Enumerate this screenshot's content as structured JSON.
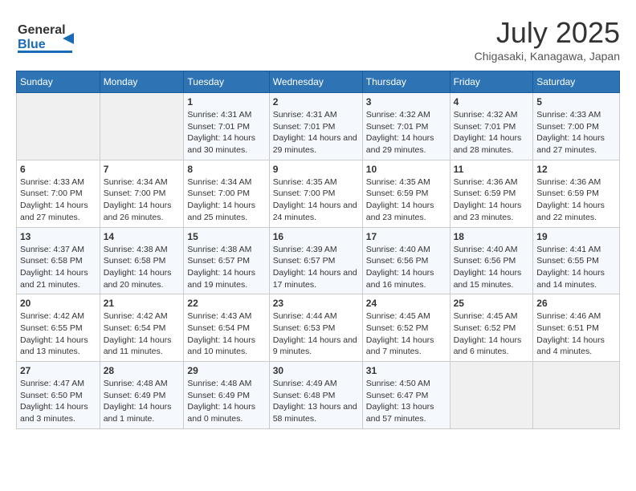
{
  "logo": {
    "line1": "General",
    "line2": "Blue"
  },
  "title": "July 2025",
  "subtitle": "Chigasaki, Kanagawa, Japan",
  "days_of_week": [
    "Sunday",
    "Monday",
    "Tuesday",
    "Wednesday",
    "Thursday",
    "Friday",
    "Saturday"
  ],
  "weeks": [
    [
      {
        "day": "",
        "sunrise": "",
        "sunset": "",
        "daylight": ""
      },
      {
        "day": "",
        "sunrise": "",
        "sunset": "",
        "daylight": ""
      },
      {
        "day": "1",
        "sunrise": "Sunrise: 4:31 AM",
        "sunset": "Sunset: 7:01 PM",
        "daylight": "Daylight: 14 hours and 30 minutes."
      },
      {
        "day": "2",
        "sunrise": "Sunrise: 4:31 AM",
        "sunset": "Sunset: 7:01 PM",
        "daylight": "Daylight: 14 hours and 29 minutes."
      },
      {
        "day": "3",
        "sunrise": "Sunrise: 4:32 AM",
        "sunset": "Sunset: 7:01 PM",
        "daylight": "Daylight: 14 hours and 29 minutes."
      },
      {
        "day": "4",
        "sunrise": "Sunrise: 4:32 AM",
        "sunset": "Sunset: 7:01 PM",
        "daylight": "Daylight: 14 hours and 28 minutes."
      },
      {
        "day": "5",
        "sunrise": "Sunrise: 4:33 AM",
        "sunset": "Sunset: 7:00 PM",
        "daylight": "Daylight: 14 hours and 27 minutes."
      }
    ],
    [
      {
        "day": "6",
        "sunrise": "Sunrise: 4:33 AM",
        "sunset": "Sunset: 7:00 PM",
        "daylight": "Daylight: 14 hours and 27 minutes."
      },
      {
        "day": "7",
        "sunrise": "Sunrise: 4:34 AM",
        "sunset": "Sunset: 7:00 PM",
        "daylight": "Daylight: 14 hours and 26 minutes."
      },
      {
        "day": "8",
        "sunrise": "Sunrise: 4:34 AM",
        "sunset": "Sunset: 7:00 PM",
        "daylight": "Daylight: 14 hours and 25 minutes."
      },
      {
        "day": "9",
        "sunrise": "Sunrise: 4:35 AM",
        "sunset": "Sunset: 7:00 PM",
        "daylight": "Daylight: 14 hours and 24 minutes."
      },
      {
        "day": "10",
        "sunrise": "Sunrise: 4:35 AM",
        "sunset": "Sunset: 6:59 PM",
        "daylight": "Daylight: 14 hours and 23 minutes."
      },
      {
        "day": "11",
        "sunrise": "Sunrise: 4:36 AM",
        "sunset": "Sunset: 6:59 PM",
        "daylight": "Daylight: 14 hours and 23 minutes."
      },
      {
        "day": "12",
        "sunrise": "Sunrise: 4:36 AM",
        "sunset": "Sunset: 6:59 PM",
        "daylight": "Daylight: 14 hours and 22 minutes."
      }
    ],
    [
      {
        "day": "13",
        "sunrise": "Sunrise: 4:37 AM",
        "sunset": "Sunset: 6:58 PM",
        "daylight": "Daylight: 14 hours and 21 minutes."
      },
      {
        "day": "14",
        "sunrise": "Sunrise: 4:38 AM",
        "sunset": "Sunset: 6:58 PM",
        "daylight": "Daylight: 14 hours and 20 minutes."
      },
      {
        "day": "15",
        "sunrise": "Sunrise: 4:38 AM",
        "sunset": "Sunset: 6:57 PM",
        "daylight": "Daylight: 14 hours and 19 minutes."
      },
      {
        "day": "16",
        "sunrise": "Sunrise: 4:39 AM",
        "sunset": "Sunset: 6:57 PM",
        "daylight": "Daylight: 14 hours and 17 minutes."
      },
      {
        "day": "17",
        "sunrise": "Sunrise: 4:40 AM",
        "sunset": "Sunset: 6:56 PM",
        "daylight": "Daylight: 14 hours and 16 minutes."
      },
      {
        "day": "18",
        "sunrise": "Sunrise: 4:40 AM",
        "sunset": "Sunset: 6:56 PM",
        "daylight": "Daylight: 14 hours and 15 minutes."
      },
      {
        "day": "19",
        "sunrise": "Sunrise: 4:41 AM",
        "sunset": "Sunset: 6:55 PM",
        "daylight": "Daylight: 14 hours and 14 minutes."
      }
    ],
    [
      {
        "day": "20",
        "sunrise": "Sunrise: 4:42 AM",
        "sunset": "Sunset: 6:55 PM",
        "daylight": "Daylight: 14 hours and 13 minutes."
      },
      {
        "day": "21",
        "sunrise": "Sunrise: 4:42 AM",
        "sunset": "Sunset: 6:54 PM",
        "daylight": "Daylight: 14 hours and 11 minutes."
      },
      {
        "day": "22",
        "sunrise": "Sunrise: 4:43 AM",
        "sunset": "Sunset: 6:54 PM",
        "daylight": "Daylight: 14 hours and 10 minutes."
      },
      {
        "day": "23",
        "sunrise": "Sunrise: 4:44 AM",
        "sunset": "Sunset: 6:53 PM",
        "daylight": "Daylight: 14 hours and 9 minutes."
      },
      {
        "day": "24",
        "sunrise": "Sunrise: 4:45 AM",
        "sunset": "Sunset: 6:52 PM",
        "daylight": "Daylight: 14 hours and 7 minutes."
      },
      {
        "day": "25",
        "sunrise": "Sunrise: 4:45 AM",
        "sunset": "Sunset: 6:52 PM",
        "daylight": "Daylight: 14 hours and 6 minutes."
      },
      {
        "day": "26",
        "sunrise": "Sunrise: 4:46 AM",
        "sunset": "Sunset: 6:51 PM",
        "daylight": "Daylight: 14 hours and 4 minutes."
      }
    ],
    [
      {
        "day": "27",
        "sunrise": "Sunrise: 4:47 AM",
        "sunset": "Sunset: 6:50 PM",
        "daylight": "Daylight: 14 hours and 3 minutes."
      },
      {
        "day": "28",
        "sunrise": "Sunrise: 4:48 AM",
        "sunset": "Sunset: 6:49 PM",
        "daylight": "Daylight: 14 hours and 1 minute."
      },
      {
        "day": "29",
        "sunrise": "Sunrise: 4:48 AM",
        "sunset": "Sunset: 6:49 PM",
        "daylight": "Daylight: 14 hours and 0 minutes."
      },
      {
        "day": "30",
        "sunrise": "Sunrise: 4:49 AM",
        "sunset": "Sunset: 6:48 PM",
        "daylight": "Daylight: 13 hours and 58 minutes."
      },
      {
        "day": "31",
        "sunrise": "Sunrise: 4:50 AM",
        "sunset": "Sunset: 6:47 PM",
        "daylight": "Daylight: 13 hours and 57 minutes."
      },
      {
        "day": "",
        "sunrise": "",
        "sunset": "",
        "daylight": ""
      },
      {
        "day": "",
        "sunrise": "",
        "sunset": "",
        "daylight": ""
      }
    ]
  ]
}
